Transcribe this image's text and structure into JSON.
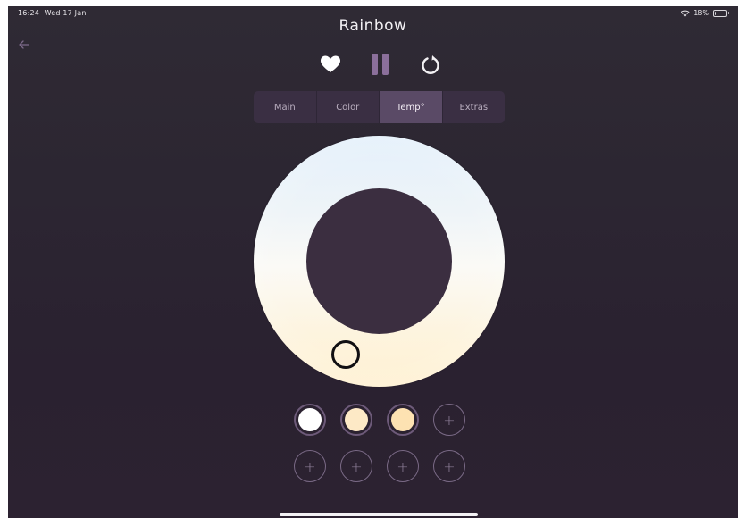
{
  "status_bar": {
    "time": "16:24",
    "date": "Wed 17 Jan",
    "battery": "18%",
    "battery_level": 0.18
  },
  "header": {
    "title": "Rainbow"
  },
  "controls": {
    "favorite_icon": "heart-icon",
    "pause_icon": "pause-icon",
    "refresh_icon": "refresh-icon"
  },
  "tabs": [
    {
      "label": "Main",
      "active": false
    },
    {
      "label": "Color",
      "active": false
    },
    {
      "label": "Temp°",
      "active": true
    },
    {
      "label": "Extras",
      "active": false
    }
  ],
  "presets": [
    {
      "color": "#ffffff",
      "empty": false
    },
    {
      "color": "#fde9c6",
      "empty": false
    },
    {
      "color": "#fde2b2",
      "empty": false
    },
    {
      "empty": true,
      "label": "+"
    },
    {
      "empty": true,
      "label": "+"
    },
    {
      "empty": true,
      "label": "+"
    },
    {
      "empty": true,
      "label": "+"
    },
    {
      "empty": true,
      "label": "+"
    }
  ],
  "colors": {
    "accent": "#5a4a66",
    "background": "#2c2632",
    "heart": "#ffffff",
    "pause": "#8b6f9b"
  }
}
